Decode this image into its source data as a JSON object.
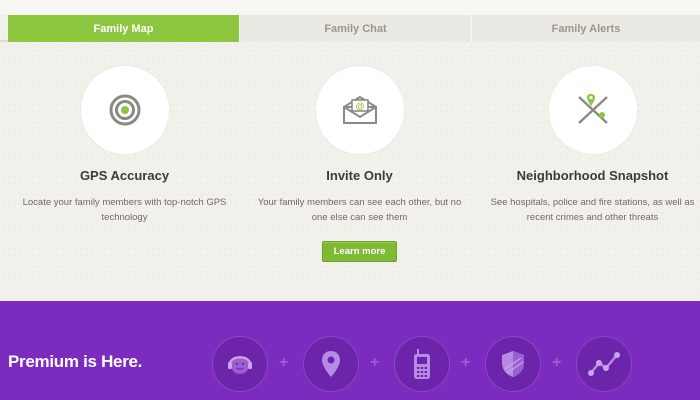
{
  "tabs": [
    {
      "label": "Family Map",
      "active": true
    },
    {
      "label": "Family Chat",
      "active": false
    },
    {
      "label": "Family Alerts",
      "active": false
    }
  ],
  "features": [
    {
      "icon": "target-icon",
      "title": "GPS Accuracy",
      "description": "Locate your family members with top-notch GPS technology"
    },
    {
      "icon": "envelope-icon",
      "title": "Invite Only",
      "description": "Your family members can see each other, but no one else can see them"
    },
    {
      "icon": "map-pin-icon",
      "title": "Neighborhood Snapshot",
      "description": "See hospitals, police and fire stations, as well as recent crimes and other threats"
    }
  ],
  "learn_more_label": "Learn more",
  "premium": {
    "title": "Premium is Here.",
    "plus": "+",
    "icons": [
      "headset-icon",
      "location-pin-icon",
      "phone-icon",
      "shield-icon",
      "chart-icon"
    ]
  },
  "colors": {
    "accent_green": "#8dc63f",
    "premium_purple": "#7b2cbf",
    "background": "#f2f0ea"
  }
}
